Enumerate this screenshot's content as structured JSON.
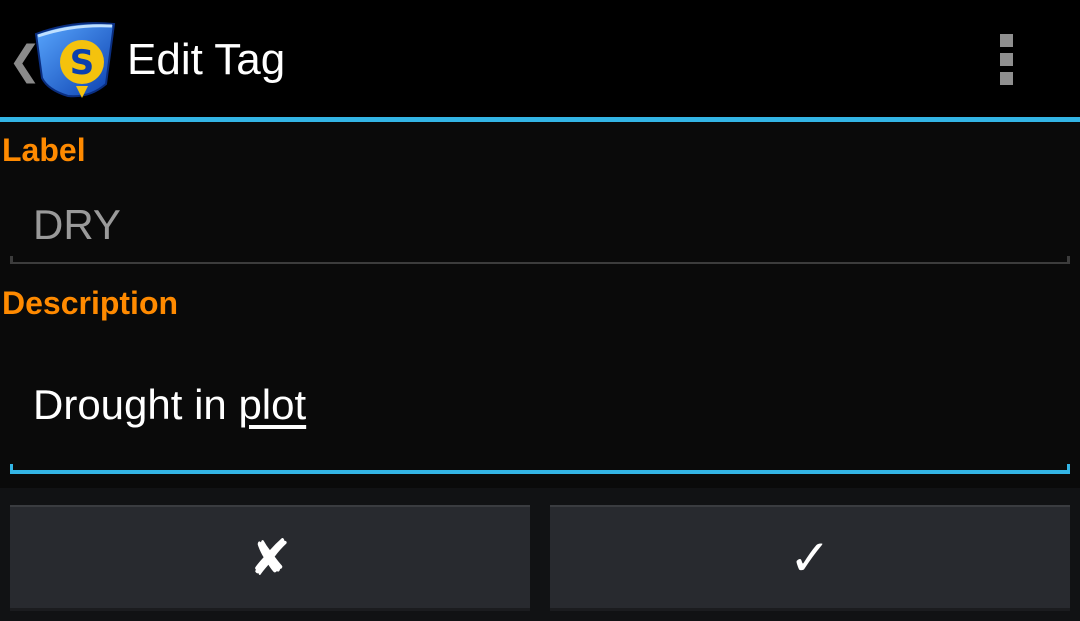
{
  "action_bar": {
    "title": "Edit Tag",
    "up_glyph": "❮",
    "app_icon": "scouting-app-icon",
    "overflow_icon": "overflow-menu-icon",
    "accent_color": "#33b5e5"
  },
  "form": {
    "label_heading": "Label",
    "label_value": "DRY",
    "description_heading": "Description",
    "description_value_prefix": "Drought in ",
    "description_value_underlined": "plot",
    "heading_color": "#ff8a00"
  },
  "buttons": {
    "cancel_glyph": "✘",
    "confirm_glyph": "✓"
  }
}
